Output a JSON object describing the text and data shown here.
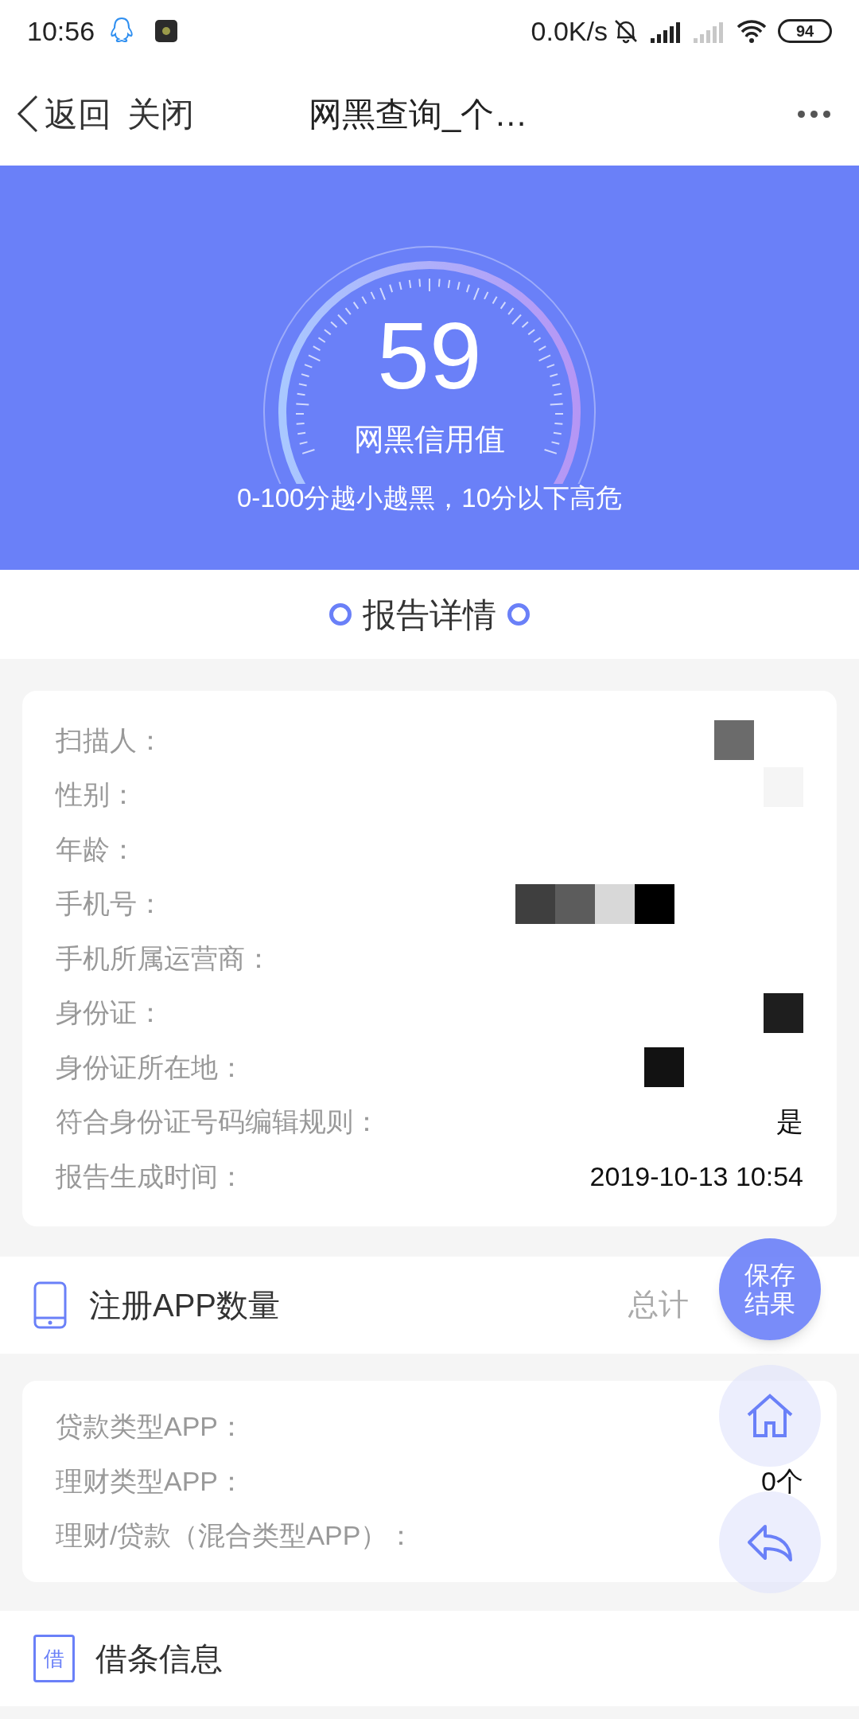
{
  "status_bar": {
    "time": "10:56",
    "speed": "0.0K/s",
    "battery": "94"
  },
  "nav": {
    "back": "返回",
    "close": "关闭",
    "title": "网黑查询_个…"
  },
  "score": {
    "value": "59",
    "label": "网黑信用值",
    "note": "0-100分越小越黑，10分以下高危"
  },
  "report": {
    "title": "报告详情",
    "rows": [
      {
        "label": "扫描人：",
        "kind": "redacted"
      },
      {
        "label": "性别：",
        "kind": "redacted"
      },
      {
        "label": "年龄：",
        "kind": "empty"
      },
      {
        "label": "手机号：",
        "kind": "redacted"
      },
      {
        "label": "手机所属运营商：",
        "kind": "empty"
      },
      {
        "label": "身份证：",
        "kind": "redacted"
      },
      {
        "label": "身份证所在地：",
        "kind": "redacted"
      },
      {
        "label": "符合身份证号码编辑规则：",
        "kind": "text",
        "value": "是"
      },
      {
        "label": "报告生成时间：",
        "kind": "text",
        "value": "2019-10-13 10:54"
      }
    ]
  },
  "apps": {
    "title": "注册APP数量",
    "total_prefix": "总计",
    "rows": [
      {
        "label": "贷款类型APP："
      },
      {
        "label": "理财类型APP：",
        "value": "0个"
      },
      {
        "label": "理财/贷款（混合类型APP）："
      }
    ]
  },
  "loan": {
    "title": "借条信息",
    "icon_text": "借"
  },
  "floating": {
    "save": "保存结果"
  }
}
